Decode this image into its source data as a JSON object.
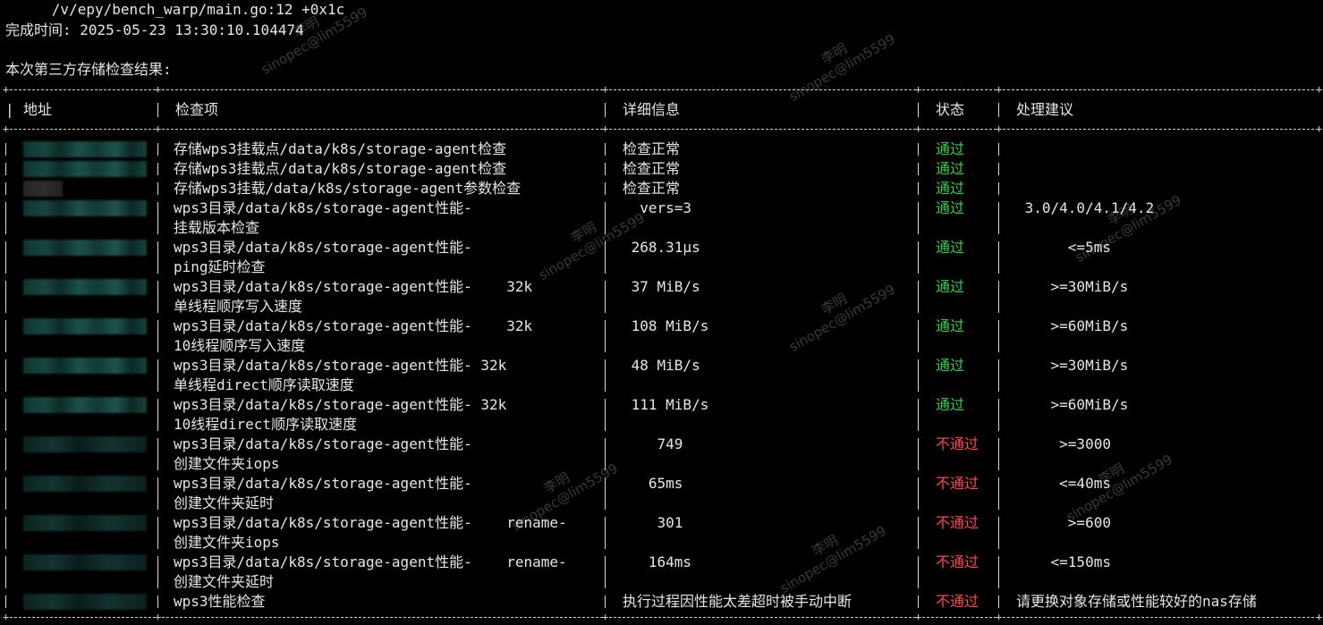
{
  "header": {
    "stack_line": "      /v/epy/bench_warp/main.go:12 +0x1c",
    "finish_time": "完成时间: 2025-05-23 13:30:10.104474",
    "result_title": "本次第三方存储检查结果:"
  },
  "table": {
    "headers": {
      "address": "地址",
      "item": "检查项",
      "detail": "详细信息",
      "status": "状态",
      "advice": "处理建议"
    },
    "rows": [
      {
        "item": "存储wps3挂载点/data/k8s/storage-agent检查",
        "item2": "",
        "detail": "检查正常",
        "status": "通过",
        "advice": "",
        "result": "pass"
      },
      {
        "item": "存储wps3挂载点/data/k8s/storage-agent检查",
        "item2": "",
        "detail": "检查正常",
        "status": "通过",
        "advice": "",
        "result": "pass"
      },
      {
        "item": "存储wps3挂载/data/k8s/storage-agent参数检查",
        "item2": "",
        "detail": "检查正常",
        "status": "通过",
        "advice": "",
        "result": "pass"
      },
      {
        "item": "wps3目录/data/k8s/storage-agent性能-",
        "item2": "挂载版本检查",
        "detail": "  vers=3",
        "status": "通过",
        "advice": " 3.0/4.0/4.1/4.2",
        "result": "pass"
      },
      {
        "item": "wps3目录/data/k8s/storage-agent性能-",
        "item2": "ping延时检查",
        "detail": " 268.31µs",
        "status": "通过",
        "advice": "      <=5ms",
        "result": "pass"
      },
      {
        "item": "wps3目录/data/k8s/storage-agent性能-    32k",
        "item2": "单线程顺序写入速度",
        "detail": " 37 MiB/s",
        "status": "通过",
        "advice": "    >=30MiB/s",
        "result": "pass"
      },
      {
        "item": "wps3目录/data/k8s/storage-agent性能-    32k",
        "item2": "10线程顺序写入速度",
        "detail": " 108 MiB/s",
        "status": "通过",
        "advice": "    >=60MiB/s",
        "result": "pass"
      },
      {
        "item": "wps3目录/data/k8s/storage-agent性能- 32k",
        "item2": "单线程direct顺序读取速度",
        "detail": " 48 MiB/s",
        "status": "通过",
        "advice": "    >=30MiB/s",
        "result": "pass"
      },
      {
        "item": "wps3目录/data/k8s/storage-agent性能- 32k",
        "item2": "10线程direct顺序读取速度",
        "detail": " 111 MiB/s",
        "status": "通过",
        "advice": "    >=60MiB/s",
        "result": "pass"
      },
      {
        "item": "wps3目录/data/k8s/storage-agent性能-",
        "item2": "创建文件夹iops",
        "detail": "    749",
        "status": "不通过",
        "advice": "     >=3000",
        "result": "fail"
      },
      {
        "item": "wps3目录/data/k8s/storage-agent性能-",
        "item2": "创建文件夹延时",
        "detail": "   65ms",
        "status": "不通过",
        "advice": "     <=40ms",
        "result": "fail"
      },
      {
        "item": "wps3目录/data/k8s/storage-agent性能-    rename-",
        "item2": "创建文件夹iops",
        "detail": "    301",
        "status": "不通过",
        "advice": "      >=600",
        "result": "fail"
      },
      {
        "item": "wps3目录/data/k8s/storage-agent性能-    rename-",
        "item2": "创建文件夹延时",
        "detail": "   164ms",
        "status": "不通过",
        "advice": "    <=150ms",
        "result": "fail"
      },
      {
        "item": "wps3性能检查",
        "item2": "",
        "detail": "执行过程因性能太差超时被手动中断",
        "status": "不通过",
        "advice": "请更换对象存储或性能较好的nas存储",
        "result": "fail"
      }
    ]
  },
  "watermark": {
    "name": "李明",
    "account": "sinopec@lim5599"
  },
  "colors": {
    "background": "#000000",
    "text": "#e6e6e6",
    "pass": "#35d04a",
    "fail": "#ff4a4a"
  }
}
